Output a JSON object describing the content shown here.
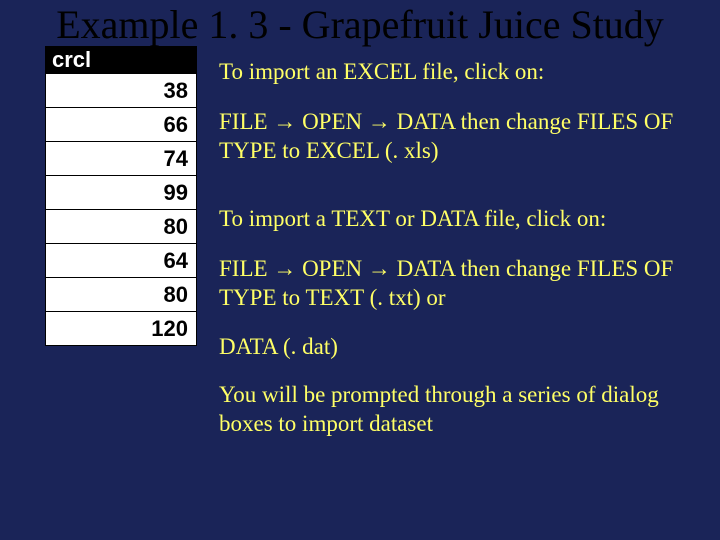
{
  "title": "Example 1. 3 - Grapefruit Juice Study",
  "table": {
    "header": "crcl",
    "values": [
      "38",
      "66",
      "74",
      "99",
      "80",
      "64",
      "80",
      "120"
    ]
  },
  "para1": "To import an EXCEL file, click on:",
  "para2a": "FILE ",
  "para2b": " OPEN ",
  "para2c": " DATA then change FILES OF TYPE to EXCEL (. xls)",
  "para3": "To import a TEXT or DATA file, click on:",
  "para4a": " FILE ",
  "para4b": " OPEN ",
  "para4c": " DATA then change FILES OF TYPE to TEXT (. txt) or",
  "para5": "DATA (. dat)",
  "para6": "You will be prompted through a series of dialog boxes to import dataset",
  "arrow": "→"
}
